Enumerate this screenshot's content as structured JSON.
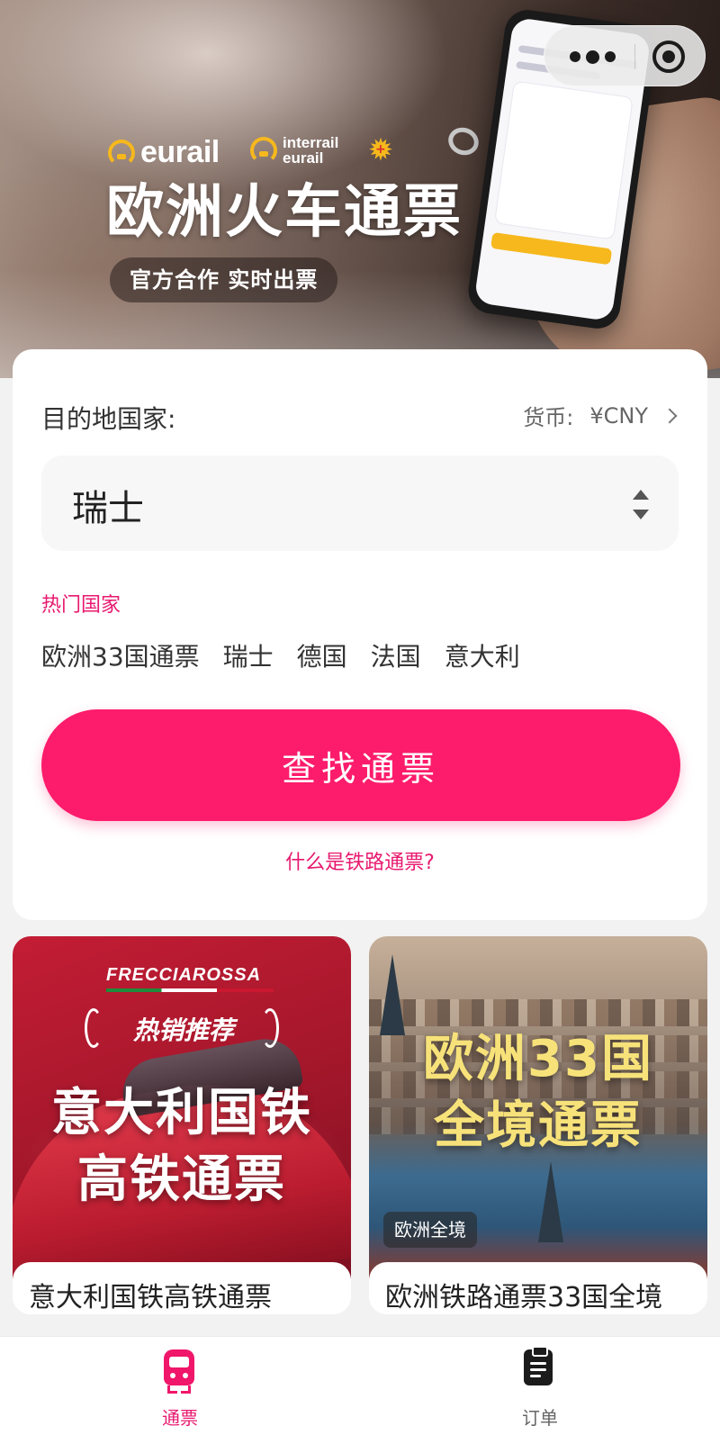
{
  "hero": {
    "brand_primary": "eurail",
    "brand_secondary_line1": "interrail",
    "brand_secondary_line2": "eurail",
    "title": "欧洲火车通票",
    "subtitle": "官方合作 实时出票"
  },
  "search": {
    "destination_label": "目的地国家:",
    "currency_label": "货币:",
    "currency_value": "¥CNY",
    "selected_country": "瑞士",
    "hot_label": "热门国家",
    "hot_countries": [
      "欧洲33国通票",
      "瑞士",
      "德国",
      "法国",
      "意大利"
    ],
    "cta_label": "查找通票",
    "help_link": "什么是铁路通票?"
  },
  "products": [
    {
      "brand": "FRECCIAROSSA",
      "badge": "热销推荐",
      "image_title": "意大利国铁\n高铁通票",
      "image_title_line1": "意大利国铁",
      "image_title_line2": "高铁通票",
      "caption": "意大利国铁高铁通票"
    },
    {
      "image_title_line1": "欧洲33国",
      "image_title_line2": "全境通票",
      "tag": "欧洲全境",
      "caption": "欧洲铁路通票33国全境"
    }
  ],
  "tabbar": {
    "tabs": [
      {
        "label": "通票",
        "icon": "train-icon",
        "active": true
      },
      {
        "label": "订单",
        "icon": "clipboard-icon",
        "active": false
      }
    ]
  },
  "colors": {
    "accent": "#fc1c6b",
    "accent_text": "#e8196f",
    "brand_yellow": "#f6b81d"
  }
}
